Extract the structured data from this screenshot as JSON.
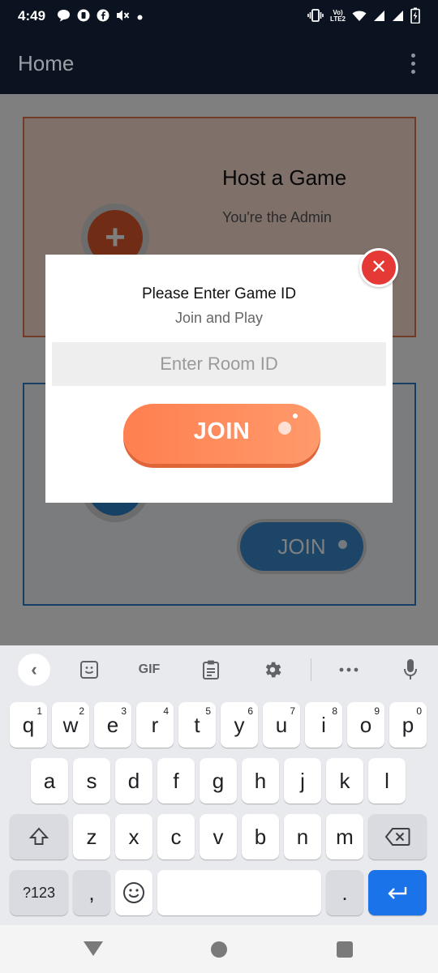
{
  "status_bar": {
    "time": "4:49",
    "lte_label": "LTE2",
    "volte_label": "Vo)",
    "icons_left": [
      "chat-bubble-icon",
      "app-circle-icon",
      "facebook-icon",
      "muted-speaker-icon",
      "dot-icon"
    ],
    "icons_right": [
      "vibrate-icon",
      "volte-icon",
      "wifi-icon",
      "signal-icon",
      "signal-icon",
      "battery-icon"
    ]
  },
  "app_bar": {
    "title": "Home"
  },
  "background": {
    "host_card": {
      "title": "Host a Game",
      "subtitle": "You're the Admin"
    },
    "join_card": {
      "button_label": "JOIN"
    }
  },
  "dialog": {
    "title": "Please Enter Game ID",
    "subtitle": "Join and Play",
    "input_placeholder": "Enter Room ID",
    "input_value": "",
    "join_label": "JOIN",
    "close_symbol": "✕"
  },
  "keyboard": {
    "toolbar": {
      "back": "‹",
      "gif": "GIF"
    },
    "row1": [
      {
        "k": "q",
        "n": "1"
      },
      {
        "k": "w",
        "n": "2"
      },
      {
        "k": "e",
        "n": "3"
      },
      {
        "k": "r",
        "n": "4"
      },
      {
        "k": "t",
        "n": "5"
      },
      {
        "k": "y",
        "n": "6"
      },
      {
        "k": "u",
        "n": "7"
      },
      {
        "k": "i",
        "n": "8"
      },
      {
        "k": "o",
        "n": "9"
      },
      {
        "k": "p",
        "n": "0"
      }
    ],
    "row2": [
      "a",
      "s",
      "d",
      "f",
      "g",
      "h",
      "j",
      "k",
      "l"
    ],
    "row3": [
      "z",
      "x",
      "c",
      "v",
      "b",
      "n",
      "m"
    ],
    "symbols_label": "?123",
    "comma": ",",
    "period": "."
  },
  "colors": {
    "accent": "#ff7f50",
    "close": "#e53935",
    "enter_key": "#1a73e8"
  }
}
